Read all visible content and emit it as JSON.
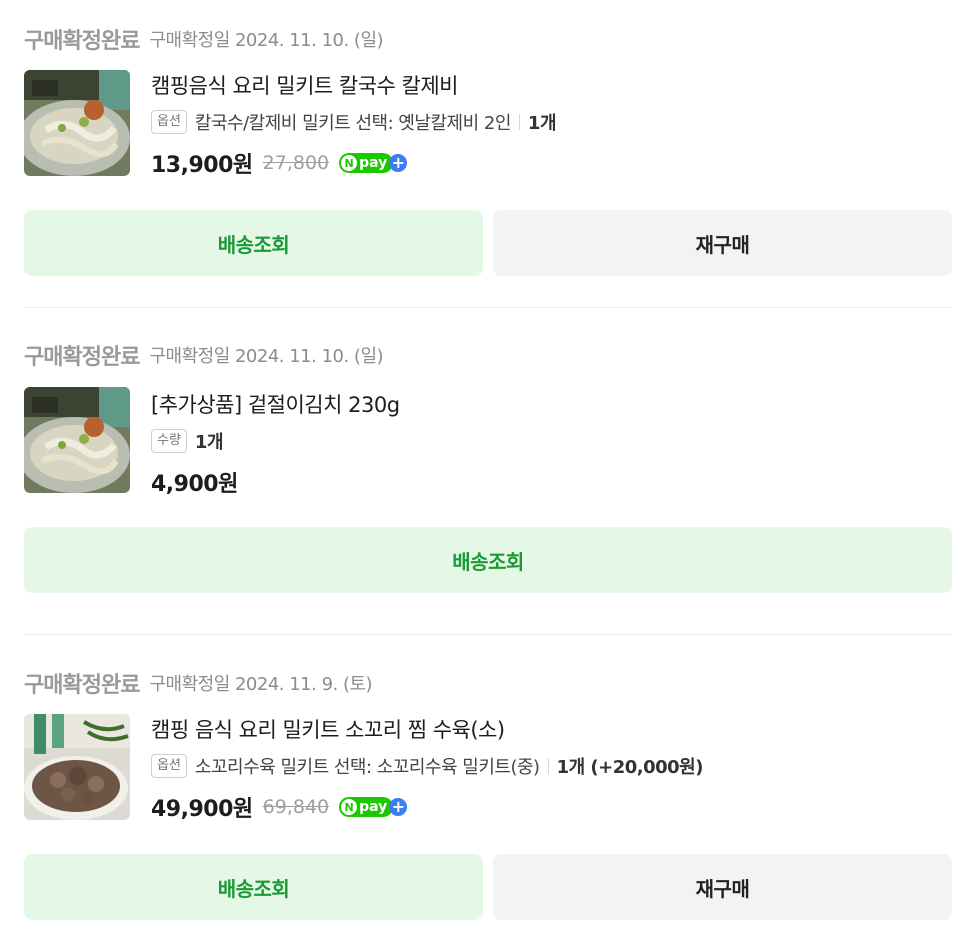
{
  "orders": [
    {
      "status": "구매확정완료",
      "confirm_date": "구매확정일 2024. 11. 10. (일)",
      "product_name": "캠핑음식 요리 밀키트 칼국수 칼제비",
      "option_tag": "옵션",
      "option_text": "칼국수/칼제비 밀키트 선택: 옛날칼제비 2인",
      "quantity": "1개",
      "price": "13,900원",
      "original_price": "27,800",
      "npay_label": "pay",
      "npay_n": "N",
      "npay_plus": "+",
      "track_button": "배송조회",
      "rebuy_button": "재구매"
    },
    {
      "status": "구매확정완료",
      "confirm_date": "구매확정일 2024. 11. 10. (일)",
      "product_name": "[추가상품] 겉절이김치 230g",
      "option_tag": "수량",
      "quantity": "1개",
      "price": "4,900원",
      "track_button": "배송조회"
    },
    {
      "status": "구매확정완료",
      "confirm_date": "구매확정일 2024. 11. 9. (토)",
      "product_name": "캠핑 음식 요리 밀키트 소꼬리 찜 수육(소)",
      "option_tag": "옵션",
      "option_text": "소꼬리수육 밀키트 선택: 소꼬리수육 밀키트(중)",
      "quantity": "1개 (+20,000원)",
      "price": "49,900원",
      "original_price": "69,840",
      "npay_label": "pay",
      "npay_n": "N",
      "npay_plus": "+",
      "track_button": "배송조회",
      "rebuy_button": "재구매"
    }
  ],
  "colors": {
    "track_bg": "#e5f8e6",
    "track_text": "#1a9a36",
    "rebuy_bg": "#f2f3f5",
    "npay_green": "#1ec800",
    "npay_blue": "#3c7cf5"
  }
}
